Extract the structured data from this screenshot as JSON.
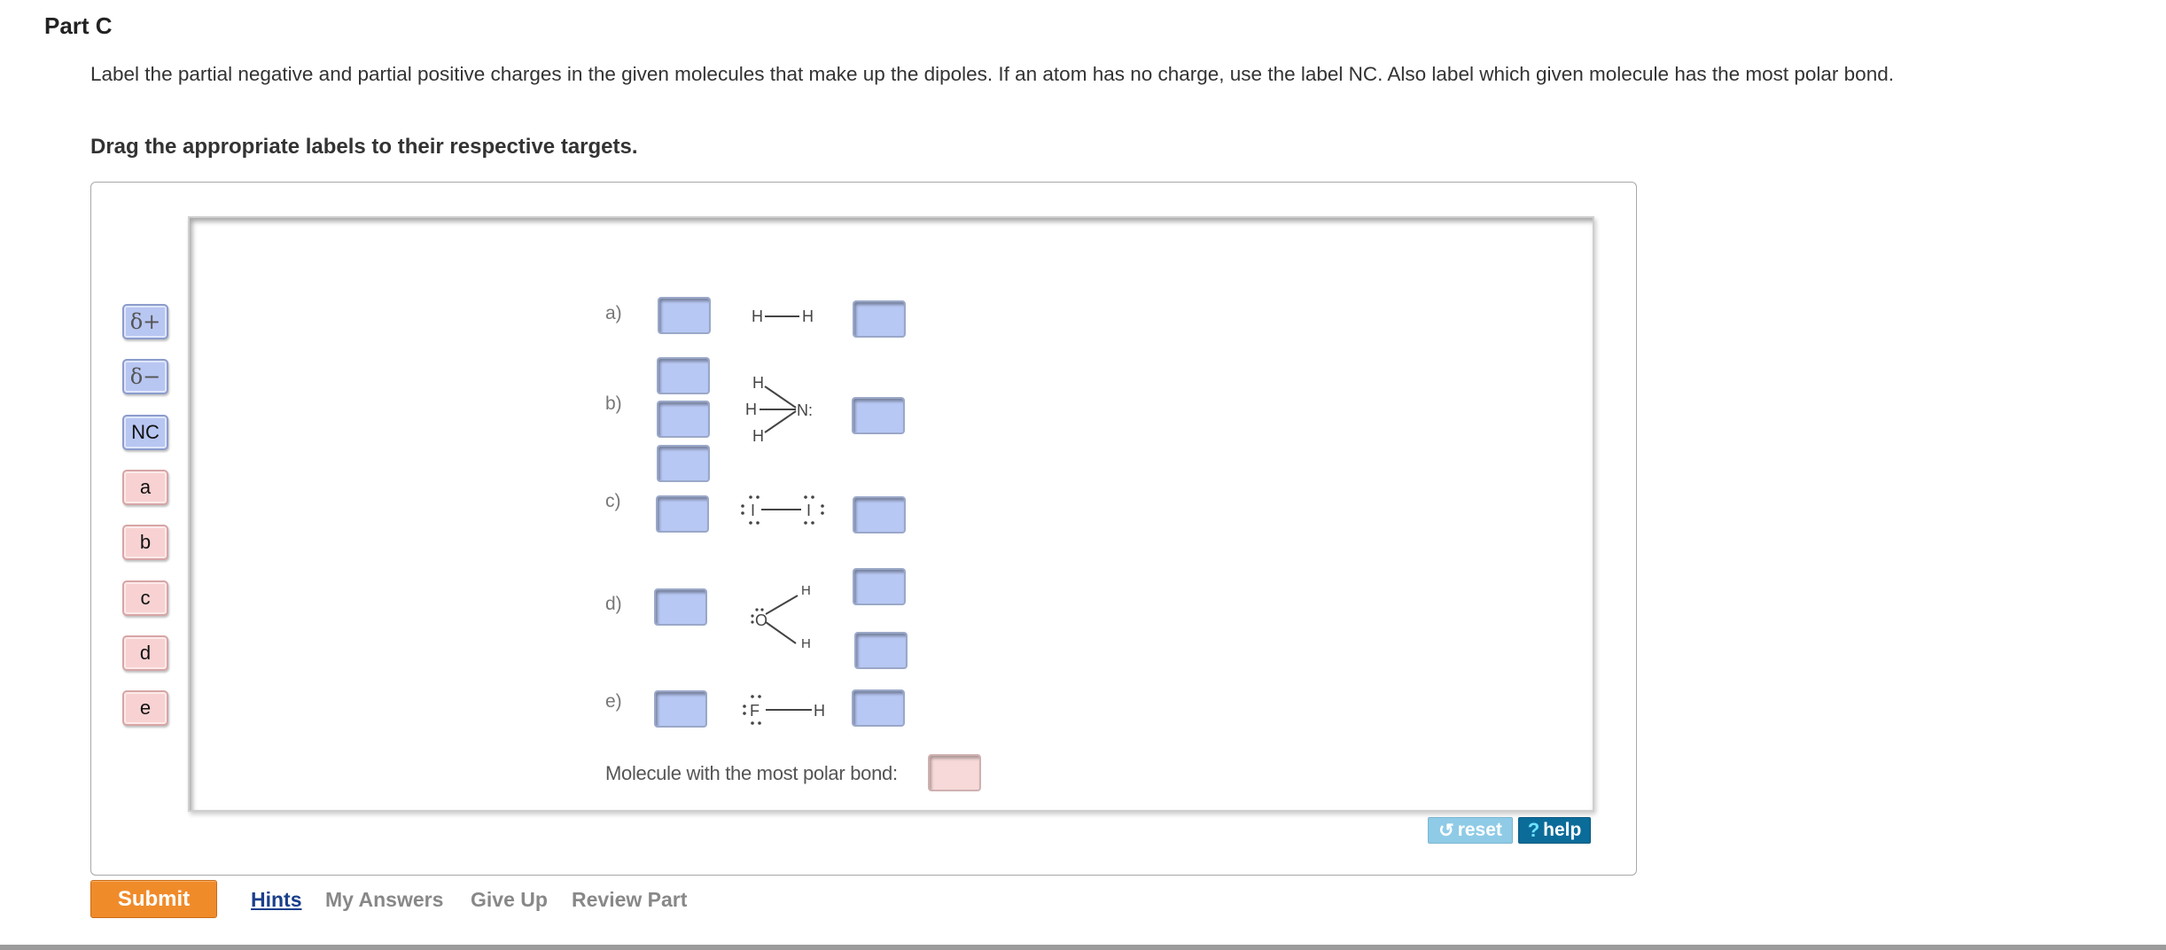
{
  "part_title": "Part C",
  "instructions": "Label the partial negative and partial positive charges in the given molecules that make up the dipoles. If an atom has no charge, use the label NC. Also label which given molecule has the most polar bond.",
  "drag_title": "Drag the appropriate labels to their respective targets.",
  "labels": {
    "delta_plus": "δ+",
    "delta_minus": "δ−",
    "nc": "NC",
    "a": "a",
    "b": "b",
    "c": "c",
    "d": "d",
    "e": "e"
  },
  "rows": {
    "a": "a)",
    "b": "b)",
    "c": "c)",
    "d": "d)",
    "e": "e)"
  },
  "atoms": {
    "H": "H",
    "N": "N:",
    "I": "I",
    "O": "O",
    "F": "F"
  },
  "polar_label": "Molecule with the most polar bond:",
  "buttons": {
    "reset": "reset",
    "help": "help",
    "submit": "Submit"
  },
  "links": {
    "hints": "Hints",
    "my_answers": "My Answers",
    "give_up": "Give Up",
    "review_part": "Review Part"
  },
  "colors": {
    "submit": "#f08b2a",
    "help": "#0b6c9a",
    "reset": "#8fcbe6",
    "charge_label": "#b8c6f2",
    "letter_label": "#f8d2d2"
  }
}
